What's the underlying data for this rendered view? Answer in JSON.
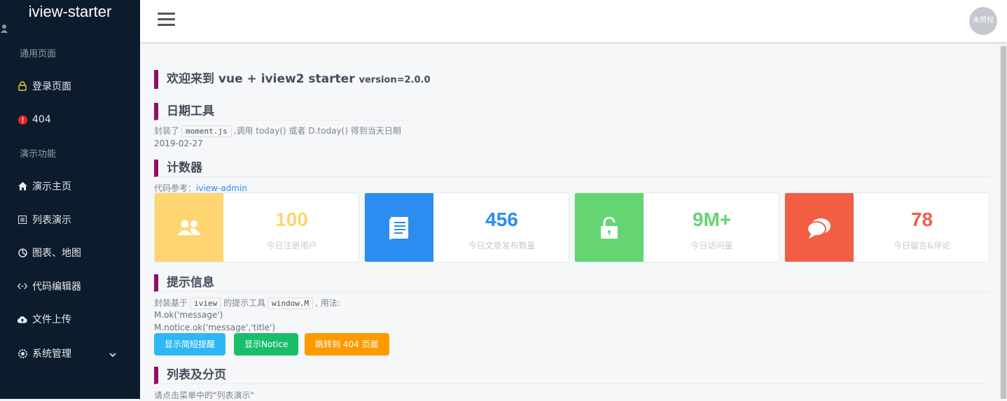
{
  "app": {
    "brand": "iview-starter"
  },
  "sidebar": {
    "groups": [
      "通用页面",
      "演示功能"
    ],
    "items": [
      {
        "label": "登录页面",
        "icon": "lock-icon"
      },
      {
        "label": "404",
        "icon": "alert-icon"
      },
      {
        "label": "演示主页",
        "icon": "home-icon"
      },
      {
        "label": "列表演示",
        "icon": "list-icon"
      },
      {
        "label": "图表、地图",
        "icon": "pie-chart-icon"
      },
      {
        "label": "代码编辑器",
        "icon": "code-icon"
      },
      {
        "label": "文件上传",
        "icon": "cloud-upload-icon"
      },
      {
        "label": "系统管理",
        "icon": "gear-icon"
      }
    ]
  },
  "header": {
    "avatar_text": "未授权"
  },
  "main": {
    "title": "欢迎来到 vue + iview2 starter",
    "version": "version=2.0.0",
    "date_section": {
      "title": "日期工具",
      "desc_pre": "封装了",
      "code": "moment.js",
      "desc_post": ",调用 today() 或者 D.today() 得到当天日期",
      "date": "2019-02-27"
    },
    "counter_section": {
      "title": "计数器",
      "ref_label": "代码参考：",
      "ref_link": "iview-admin",
      "cards": [
        {
          "value": "100",
          "label": "今日注册用户",
          "color": "#ffd572",
          "num_color": "#ffd572",
          "icon": "users-icon"
        },
        {
          "value": "456",
          "label": "今日文章发布数量",
          "color": "#2d8cf0",
          "num_color": "#2d8cf0",
          "icon": "document-icon"
        },
        {
          "value": "9M+",
          "label": "今日访问量",
          "color": "#64d572",
          "num_color": "#64d572",
          "icon": "unlock-icon"
        },
        {
          "value": "78",
          "label": "今日留言&评论",
          "color": "#f25e43",
          "num_color": "#f25e43",
          "icon": "chat-icon"
        }
      ]
    },
    "tips_section": {
      "title": "提示信息",
      "desc_pre": "封装基于",
      "code1": "iview",
      "desc_mid": "的提示工具",
      "code2": "window.M",
      "desc_post": ", 用法:",
      "line1": "M.ok('message')",
      "line2": "M.notice.ok('message','title')",
      "buttons": [
        {
          "label": "显示简短提醒",
          "color": "#2db7f5"
        },
        {
          "label": "显示Notice",
          "color": "#19be6b"
        },
        {
          "label": "跳转到 404 页面",
          "color": "#ff9900"
        }
      ]
    },
    "list_section": {
      "title": "列表及分页",
      "desc": "请点击菜单中的\"列表演示\""
    }
  }
}
